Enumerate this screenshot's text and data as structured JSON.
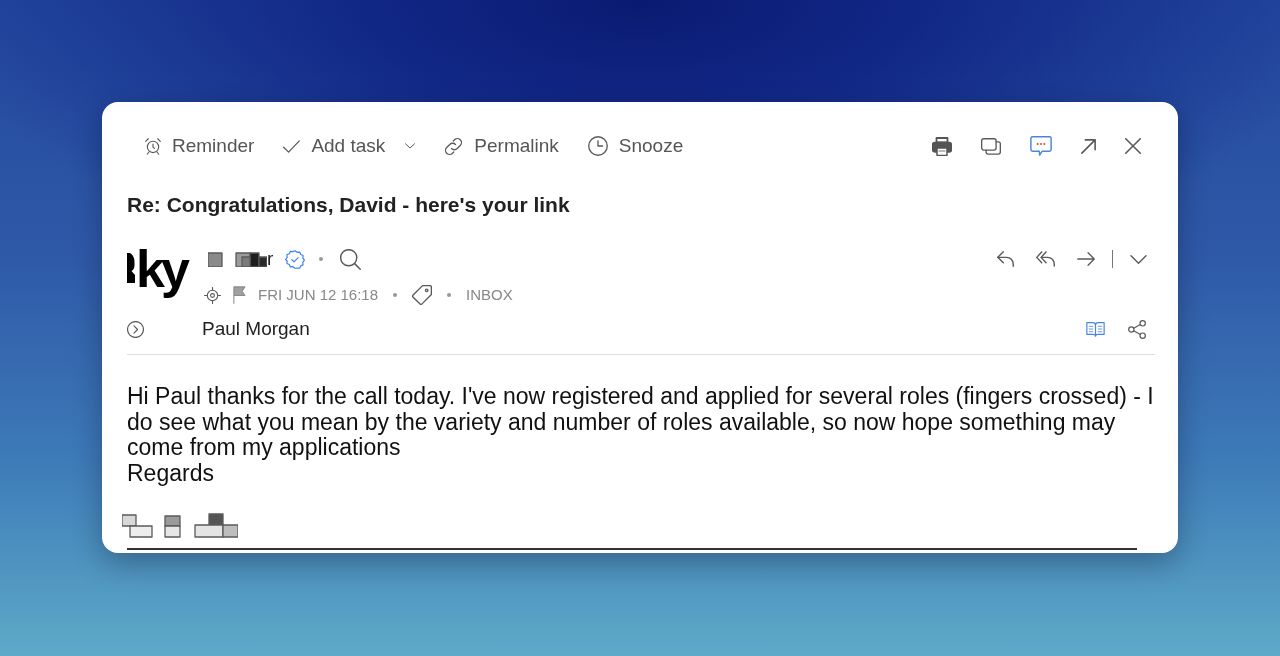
{
  "toolbar": {
    "actions": [
      {
        "kind": "reminder",
        "label": "Reminder",
        "dropdown": false
      },
      {
        "kind": "task",
        "label": "Add task",
        "dropdown": true
      },
      {
        "kind": "permalink",
        "label": "Permalink",
        "dropdown": false
      },
      {
        "kind": "snooze",
        "label": "Snooze",
        "dropdown": false
      }
    ]
  },
  "subject": "Re: Congratulations, David - here's your link",
  "sender": {
    "logo_text": "ky",
    "name_visible": "r",
    "verified": true,
    "flagged": false,
    "date": "FRI JUN 12 16:18",
    "folder": "INBOX"
  },
  "recipient": {
    "name": "Paul Morgan"
  },
  "body": {
    "paragraphs": [
      "Hi Paul thanks for the call today. I've now registered and applied for several roles (fingers crossed) - I do see what you mean by the variety and number of roles available, so now hope something may come from my applications",
      "Regards"
    ]
  }
}
